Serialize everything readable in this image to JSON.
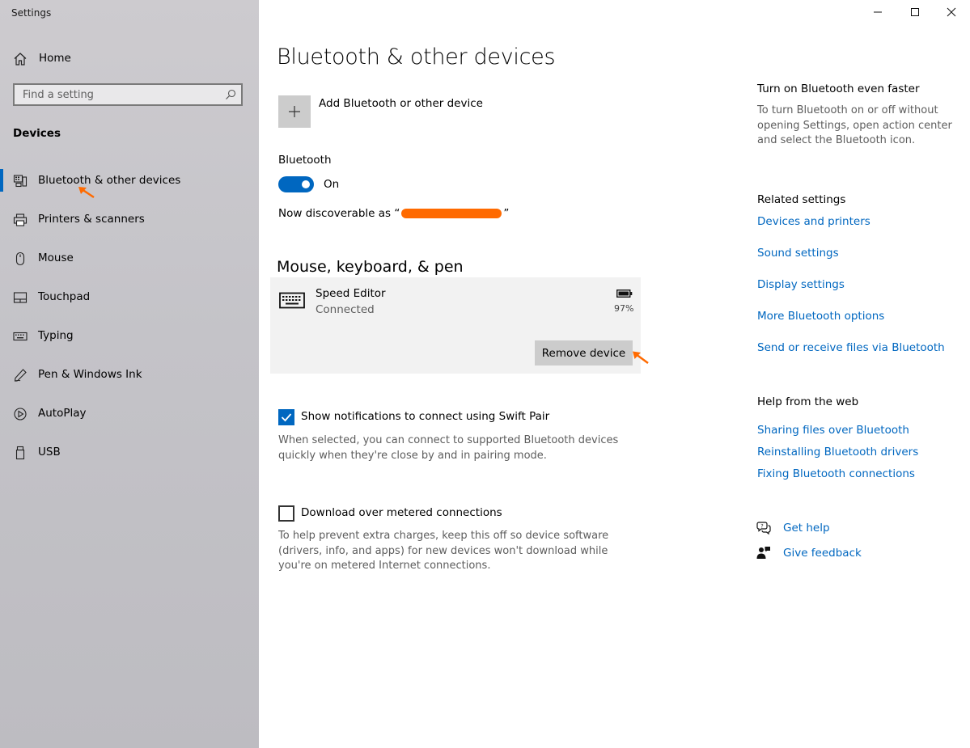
{
  "window": {
    "title": "Settings"
  },
  "sidebar": {
    "home_label": "Home",
    "search_placeholder": "Find a setting",
    "section": "Devices",
    "items": [
      {
        "label": "Bluetooth & other devices",
        "icon": "bluetooth-devices-icon",
        "selected": true
      },
      {
        "label": "Printers & scanners",
        "icon": "printer-icon"
      },
      {
        "label": "Mouse",
        "icon": "mouse-icon"
      },
      {
        "label": "Touchpad",
        "icon": "touchpad-icon"
      },
      {
        "label": "Typing",
        "icon": "keyboard-icon"
      },
      {
        "label": "Pen & Windows Ink",
        "icon": "pen-icon"
      },
      {
        "label": "AutoPlay",
        "icon": "autoplay-icon"
      },
      {
        "label": "USB",
        "icon": "usb-icon"
      }
    ]
  },
  "main": {
    "title": "Bluetooth & other devices",
    "add_device_label": "Add Bluetooth or other device",
    "bluetooth_label": "Bluetooth",
    "bluetooth_state": "On",
    "discoverable_prefix": "Now discoverable as “",
    "discoverable_suffix": "”",
    "section_title": "Mouse, keyboard, & pen",
    "device": {
      "name": "Speed Editor",
      "status": "Connected",
      "battery": "97%",
      "remove_label": "Remove device"
    },
    "swift_pair": {
      "label": "Show notifications to connect using Swift Pair",
      "checked": true,
      "description": "When selected, you can connect to supported Bluetooth devices quickly when they're close by and in pairing mode."
    },
    "metered": {
      "label": "Download over metered connections",
      "checked": false,
      "description": "To help prevent extra charges, keep this off so device software (drivers, info, and apps) for new devices won't download while you're on metered Internet connections."
    }
  },
  "right_panel": {
    "faster_title": "Turn on Bluetooth even faster",
    "faster_desc": "To turn Bluetooth on or off without opening Settings, open action center and select the Bluetooth icon.",
    "related_title": "Related settings",
    "related_links": [
      "Devices and printers",
      "Sound settings",
      "Display settings",
      "More Bluetooth options",
      "Send or receive files via Bluetooth"
    ],
    "help_title": "Help from the web",
    "help_links": [
      "Sharing files over Bluetooth",
      "Reinstalling Bluetooth drivers",
      "Fixing Bluetooth connections"
    ],
    "get_help": "Get help",
    "give_feedback": "Give feedback"
  },
  "colors": {
    "accent": "#0067c0",
    "annotation": "#ff6a00"
  }
}
